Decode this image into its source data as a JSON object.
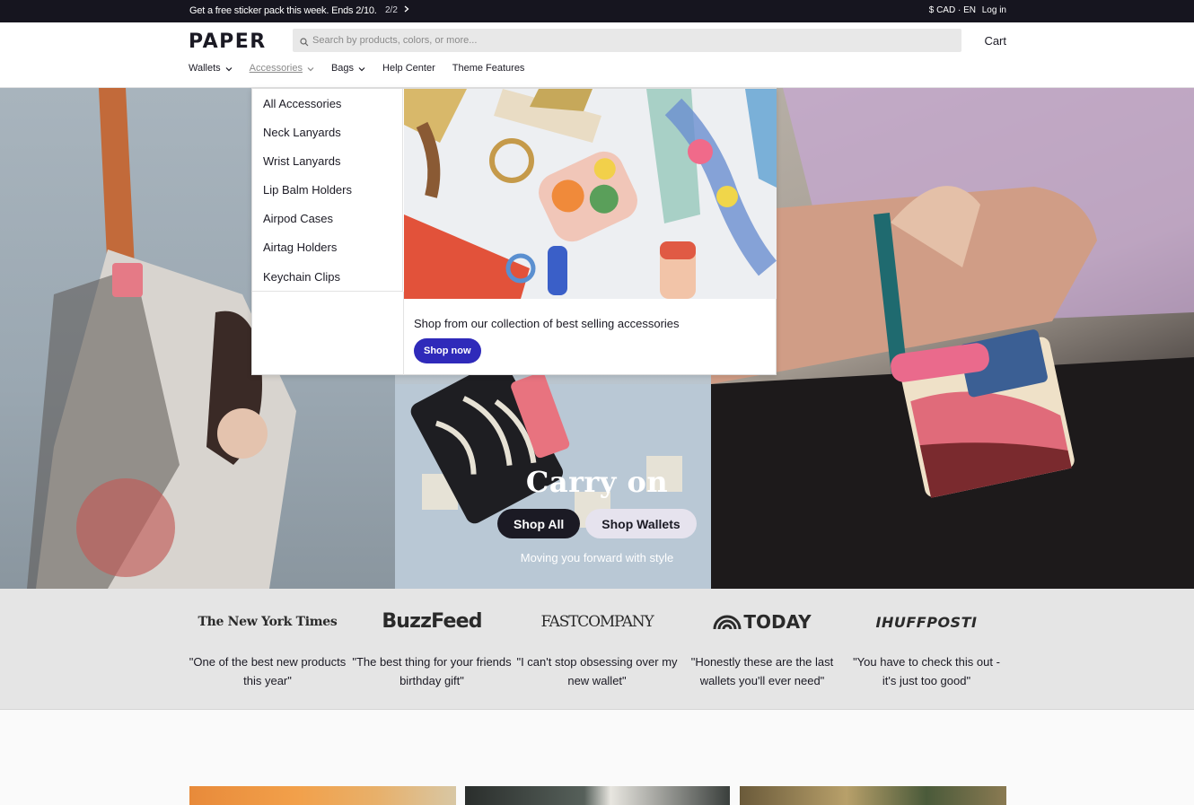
{
  "announcement": {
    "message": "Get a free sticker pack this week. Ends 2/10.",
    "pager": "2/2",
    "currency_lang": "$ CAD · EN",
    "login": "Log in"
  },
  "header": {
    "logo": "PAPER",
    "search_placeholder": "Search by products, colors, or more...",
    "cart": "Cart",
    "nav": {
      "wallets": "Wallets",
      "accessories": "Accessories",
      "bags": "Bags",
      "help": "Help Center",
      "theme": "Theme Features"
    }
  },
  "dropdown": {
    "links": {
      "all": "All Accessories",
      "neck": "Neck Lanyards",
      "wrist": "Wrist Lanyards",
      "lipbalm": "Lip Balm Holders",
      "airpod": "Airpod Cases",
      "airtag": "Airtag Holders",
      "keychain": "Keychain Clips"
    },
    "promo_text": "Shop from our collection of best selling accessories",
    "promo_button": "Shop now"
  },
  "hero": {
    "title": "Carry on",
    "primary_button": "Shop All",
    "secondary_button": "Shop Wallets",
    "subtitle": "Moving you forward with style"
  },
  "press": {
    "nyt": {
      "logo": "The New York Times",
      "quote": "\"One of the best new products this year\""
    },
    "buzzfeed": {
      "logo": "BuzzFeed",
      "quote": "\"The best thing for your friends birthday gift\""
    },
    "fastco": {
      "logo": "FASTCOMPANY",
      "quote": "\"I can't stop obsessing over my new wallet\""
    },
    "today": {
      "logo": "TODAY",
      "quote": "\"Honestly these are the last wallets you'll ever need\""
    },
    "huffpost": {
      "logo": "IHUFFPOSTI",
      "quote": "\"You have to check this out - it's just too good\""
    }
  },
  "colors": {
    "accent_button": "#2f2aba",
    "dark": "#1b1a24",
    "announcement_bg": "#16151f"
  }
}
